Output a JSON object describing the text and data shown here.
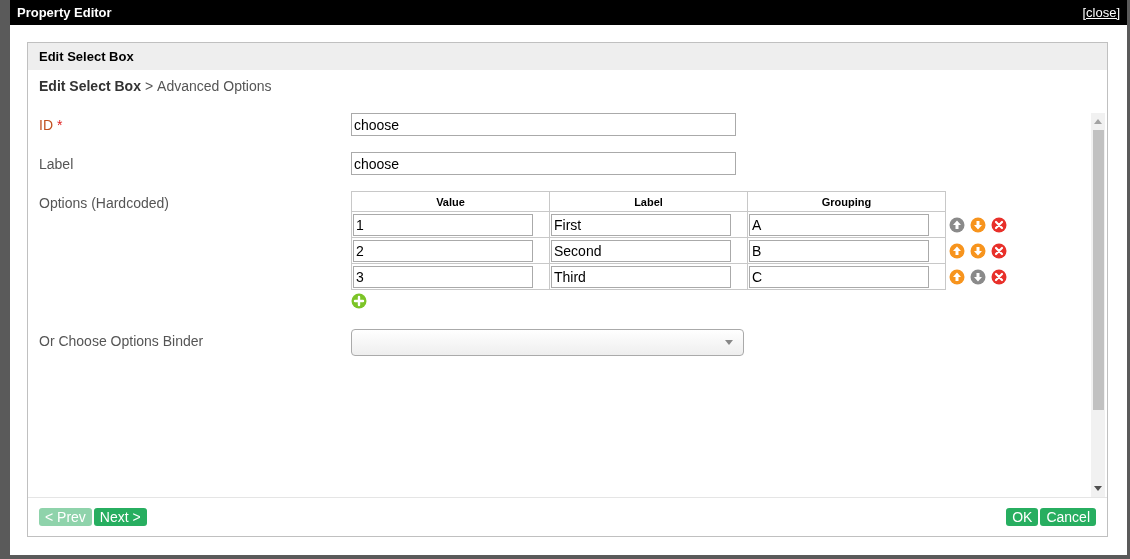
{
  "window": {
    "title": "Property Editor",
    "close": "[close]"
  },
  "panel": {
    "title": "Edit Select Box",
    "breadcrumb": {
      "parent": "Edit Select Box",
      "separator": ">",
      "current": "Advanced Options"
    }
  },
  "fields": [
    {
      "label": "ID",
      "required": true,
      "required_mark": "*",
      "value": "choose"
    },
    {
      "label": "Label",
      "required": false,
      "value": "choose"
    }
  ],
  "options": {
    "label": "Options (Hardcoded)",
    "columns": [
      "Value",
      "Label",
      "Grouping"
    ],
    "rows": [
      {
        "cells": [
          "1",
          "First",
          "A"
        ],
        "can_move_up": false,
        "can_move_down": true
      },
      {
        "cells": [
          "2",
          "Second",
          "B"
        ],
        "can_move_up": true,
        "can_move_down": true
      },
      {
        "cells": [
          "3",
          "Third",
          "C"
        ],
        "can_move_up": true,
        "can_move_down": false
      }
    ]
  },
  "binder": {
    "label": "Or Choose Options Binder"
  },
  "footer": {
    "prev": {
      "label": "< Prev",
      "disabled": true
    },
    "next": {
      "label": "Next >",
      "disabled": false
    },
    "ok": "OK",
    "cancel": "Cancel"
  }
}
